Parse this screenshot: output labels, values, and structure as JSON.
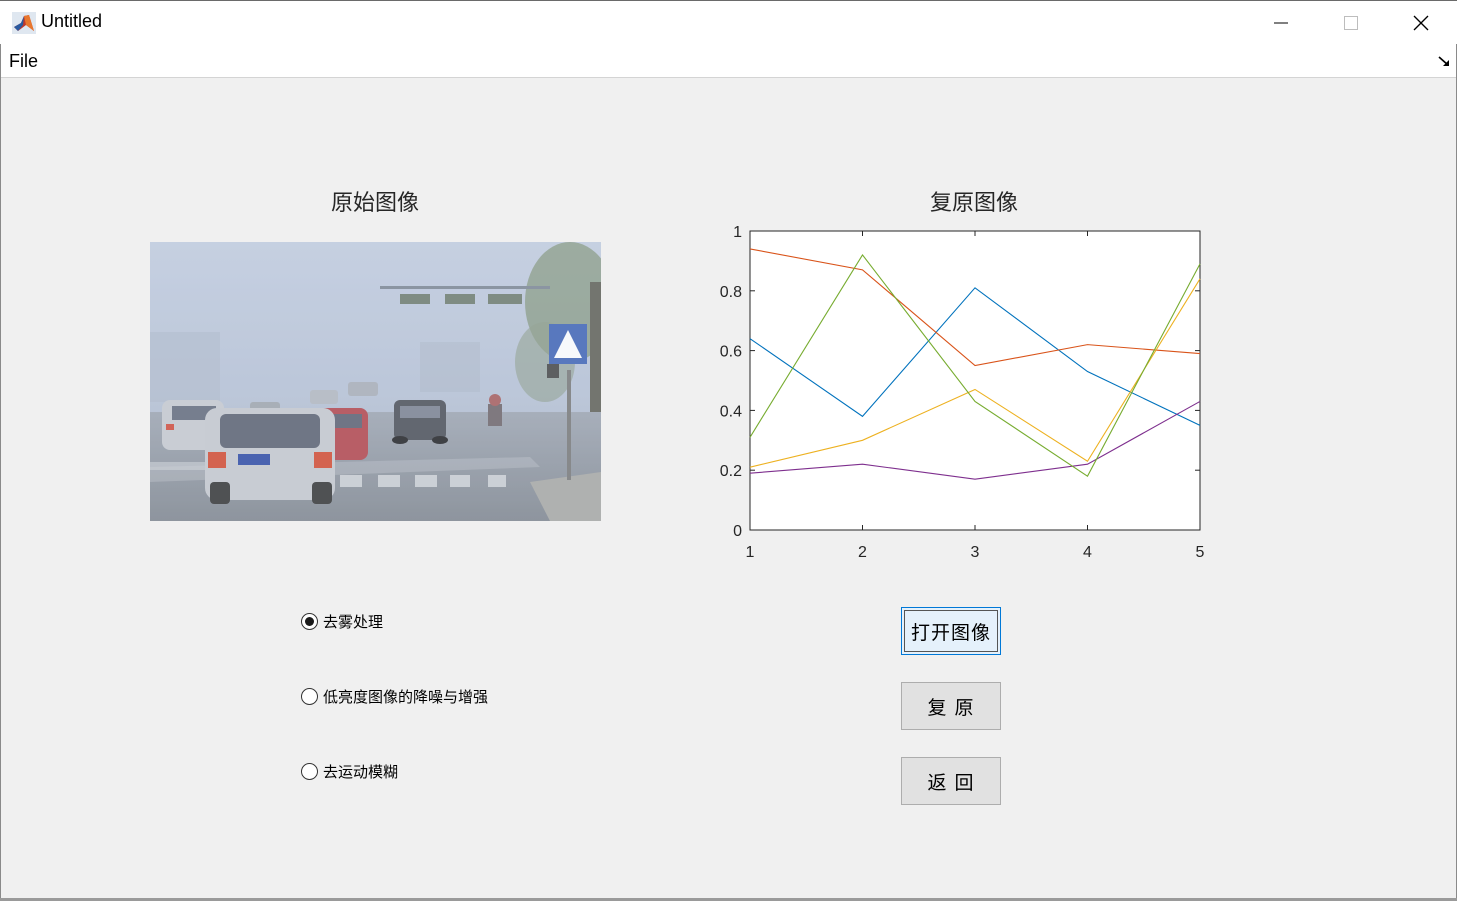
{
  "window": {
    "title": "Untitled",
    "controls": [
      "minimize-icon",
      "maximize-icon",
      "close-icon"
    ]
  },
  "menubar": {
    "items": [
      {
        "label": "File"
      }
    ]
  },
  "original_panel": {
    "title": "原始图像",
    "image_description_icon": "foggy-street-photo"
  },
  "restored_panel": {
    "title": "复原图像"
  },
  "options": [
    {
      "label": "去雾处理",
      "checked": true
    },
    {
      "label": "低亮度图像的降噪与增强",
      "checked": false
    },
    {
      "label": "去运动模糊",
      "checked": false
    }
  ],
  "buttons": {
    "open": "打开图像",
    "restore": "复 原",
    "back": "返 回"
  },
  "chart_data": {
    "type": "line",
    "x": [
      1,
      2,
      3,
      4,
      5
    ],
    "xlim": [
      1,
      5
    ],
    "ylim": [
      0,
      1
    ],
    "xticks": [
      "1",
      "2",
      "3",
      "4",
      "5"
    ],
    "yticks": [
      "0",
      "0.2",
      "0.4",
      "0.6",
      "0.8",
      "1"
    ],
    "grid": false,
    "series": [
      {
        "values": [
          0.64,
          0.38,
          0.81,
          0.53,
          0.35
        ],
        "color": "#0072bd"
      },
      {
        "values": [
          0.94,
          0.87,
          0.55,
          0.62,
          0.59
        ],
        "color": "#d95319"
      },
      {
        "values": [
          0.21,
          0.3,
          0.47,
          0.23,
          0.84
        ],
        "color": "#edb120"
      },
      {
        "values": [
          0.19,
          0.22,
          0.17,
          0.22,
          0.43
        ],
        "color": "#7e2f8e"
      },
      {
        "values": [
          0.31,
          0.92,
          0.43,
          0.18,
          0.89
        ],
        "color": "#77ac30"
      }
    ]
  }
}
